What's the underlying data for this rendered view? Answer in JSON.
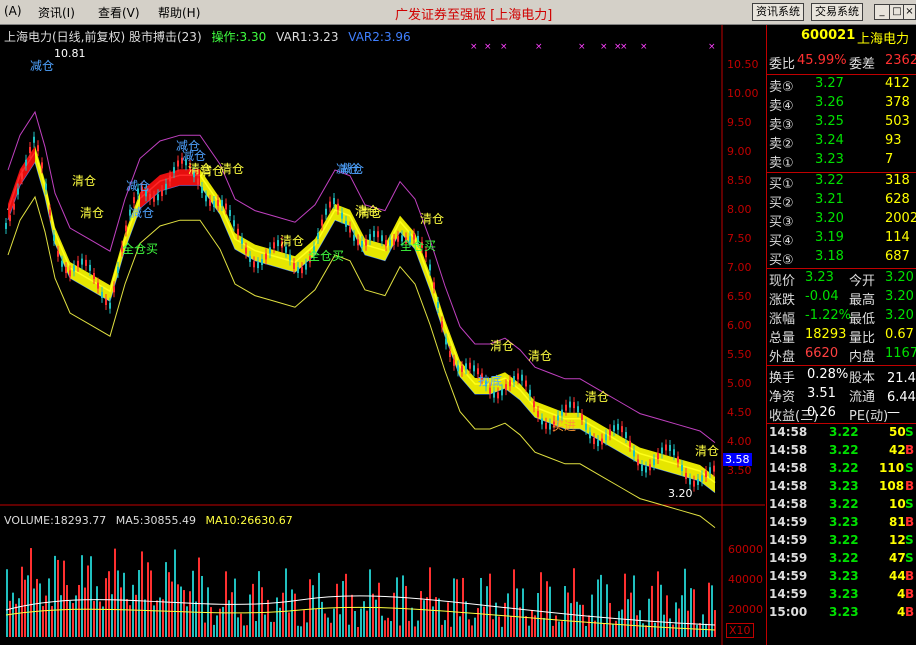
{
  "menubar": {
    "items": [
      "(A)",
      "资讯(I)",
      "查看(V)",
      "帮助(H)"
    ],
    "title": "广发证券至强版 [上海电力]",
    "btn_info": "资讯系统",
    "btn_trade": "交易系统",
    "win_min": "_",
    "win_max": "□",
    "win_close": "×"
  },
  "chart_info": {
    "name": "上海电力(日线,前复权) 股市搏击(23)",
    "op": "操作:3.30",
    "var1": "VAR1:3.23",
    "var2": "VAR2:3.96"
  },
  "price_axis": [
    "10.50",
    "10.00",
    "9.50",
    "9.00",
    "8.50",
    "8.00",
    "7.50",
    "7.00",
    "6.50",
    "6.00",
    "5.50",
    "5.00",
    "4.50",
    "4.00",
    "3.50"
  ],
  "price_marker": "3.58",
  "high_label": "10.81",
  "low_label": "3.20",
  "volume_info": {
    "vol": "VOLUME:18293.77",
    "ma5": "MA5:30855.49",
    "ma10": "MA10:26630.67"
  },
  "volume_axis": [
    "60000",
    "40000",
    "20000"
  ],
  "volume_unit": "X10",
  "signals": [
    {
      "t": "减仓",
      "c": "#4fa3ff"
    },
    {
      "t": "清仓",
      "c": "#ffff40"
    },
    {
      "t": "减仓",
      "c": "#4fa3ff"
    },
    {
      "t": "减仓",
      "c": "#4fa3ff"
    },
    {
      "t": "全仓买",
      "c": "#40ff40"
    },
    {
      "t": "清仓",
      "c": "#ffff40"
    },
    {
      "t": "减仓",
      "c": "#4fa3ff"
    },
    {
      "t": "清仓",
      "c": "#ffff40"
    },
    {
      "t": "清仓",
      "c": "#ffff40"
    },
    {
      "t": "清仓",
      "c": "#ffff40"
    },
    {
      "t": "减仓",
      "c": "#4fa3ff"
    },
    {
      "t": "清仓",
      "c": "#ffff40"
    },
    {
      "t": "全仓买",
      "c": "#40ff40"
    },
    {
      "t": "清仓",
      "c": "#ffff40"
    },
    {
      "t": "全仓买",
      "c": "#40ff40"
    },
    {
      "t": "清仓",
      "c": "#ffff40"
    },
    {
      "t": "抄底",
      "c": "#4fa3ff"
    },
    {
      "t": "清仓",
      "c": "#ffff40"
    },
    {
      "t": "清仓",
      "c": "#ffff40"
    },
    {
      "t": "买进",
      "c": "#ff9933"
    },
    {
      "t": "清仓",
      "c": "#ffff40"
    },
    {
      "t": "清仓",
      "c": "#ffff40"
    },
    {
      "t": "减仓",
      "c": "#4fa3ff"
    },
    {
      "t": "减仓",
      "c": "#4fa3ff"
    },
    {
      "t": "清仓",
      "c": "#ffff40"
    }
  ],
  "quote": {
    "code": "600021",
    "name": "上海电力",
    "weibi_label": "委比",
    "weibi": "45.99%",
    "weicha_label": "委差",
    "weicha": "2362",
    "sell": [
      {
        "label": "卖⑤",
        "price": "3.27",
        "vol": "412"
      },
      {
        "label": "卖④",
        "price": "3.26",
        "vol": "378"
      },
      {
        "label": "卖③",
        "price": "3.25",
        "vol": "503"
      },
      {
        "label": "卖②",
        "price": "3.24",
        "vol": "93"
      },
      {
        "label": "卖①",
        "price": "3.23",
        "vol": "7"
      }
    ],
    "buy": [
      {
        "label": "买①",
        "price": "3.22",
        "vol": "318"
      },
      {
        "label": "买②",
        "price": "3.21",
        "vol": "628"
      },
      {
        "label": "买③",
        "price": "3.20",
        "vol": "2002"
      },
      {
        "label": "买④",
        "price": "3.19",
        "vol": "114"
      },
      {
        "label": "买⑤",
        "price": "3.18",
        "vol": "687"
      }
    ],
    "stats": [
      {
        "l1": "现价",
        "v1": "3.23",
        "c1": "#00e000",
        "l2": "今开",
        "v2": "3.20",
        "c2": "#00e000"
      },
      {
        "l1": "涨跌",
        "v1": "-0.04",
        "c1": "#00e000",
        "l2": "最高",
        "v2": "3.20",
        "c2": "#00e000"
      },
      {
        "l1": "涨幅",
        "v1": "-1.22%",
        "c1": "#00e000",
        "l2": "最低",
        "v2": "3.20",
        "c2": "#00e000"
      },
      {
        "l1": "总量",
        "v1": "18293",
        "c1": "#ffff00",
        "l2": "量比",
        "v2": "0.67",
        "c2": "#ffff00"
      },
      {
        "l1": "外盘",
        "v1": "6620",
        "c1": "#ff4040",
        "l2": "内盘",
        "v2": "11673",
        "c2": "#00e000"
      }
    ],
    "stats2": [
      {
        "l1": "换手",
        "v1": "0.28%",
        "c1": "#ffffff",
        "l2": "股本",
        "v2": "21.4亿",
        "c2": "#ffffff"
      },
      {
        "l1": "净资",
        "v1": "3.51",
        "c1": "#ffffff",
        "l2": "流通",
        "v2": "6.44亿",
        "c2": "#ffffff"
      },
      {
        "l1": "收益(三)",
        "v1": "0.26",
        "c1": "#ffffff",
        "l2": "PE(动)",
        "v2": "—",
        "c2": "#ffffff"
      }
    ]
  },
  "ticks": [
    {
      "time": "14:58",
      "price": "3.22",
      "vol": "50",
      "bs": "S"
    },
    {
      "time": "14:58",
      "price": "3.22",
      "vol": "42",
      "bs": "B"
    },
    {
      "time": "14:58",
      "price": "3.22",
      "vol": "110",
      "bs": "S"
    },
    {
      "time": "14:58",
      "price": "3.23",
      "vol": "108",
      "bs": "B"
    },
    {
      "time": "14:58",
      "price": "3.22",
      "vol": "10",
      "bs": "S"
    },
    {
      "time": "14:59",
      "price": "3.23",
      "vol": "81",
      "bs": "B"
    },
    {
      "time": "14:59",
      "price": "3.22",
      "vol": "12",
      "bs": "S"
    },
    {
      "time": "14:59",
      "price": "3.22",
      "vol": "47",
      "bs": "S"
    },
    {
      "time": "14:59",
      "price": "3.23",
      "vol": "44",
      "bs": "B"
    },
    {
      "time": "14:59",
      "price": "3.23",
      "vol": "4",
      "bs": "B"
    },
    {
      "time": "15:00",
      "price": "3.23",
      "vol": "4",
      "bs": "B"
    }
  ],
  "colors": {
    "up": "#ff3030",
    "down": "#00e000",
    "accent": "#ffff00",
    "border": "#c00000"
  }
}
